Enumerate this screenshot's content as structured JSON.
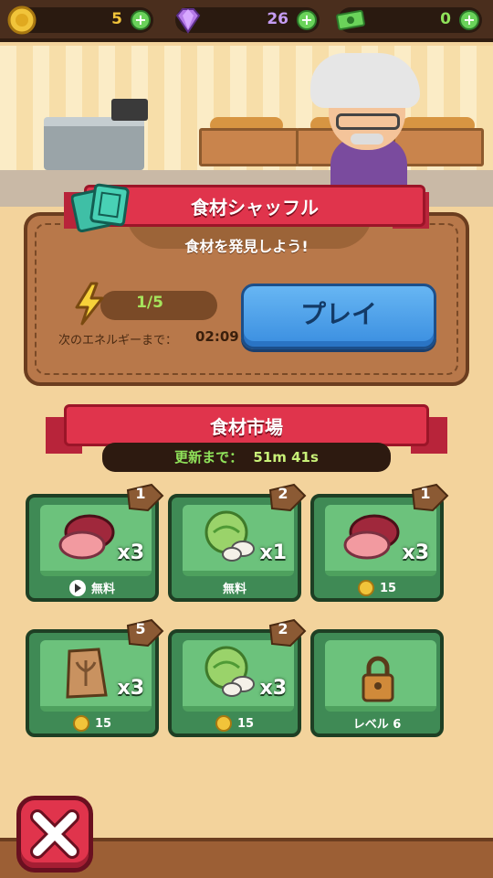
{
  "currency": {
    "coins": "5",
    "gems": "26",
    "cash": "0",
    "plus_symbol": "+"
  },
  "shuffle": {
    "title": "食材シャッフル",
    "subtitle": "食材を発見しよう!",
    "energy": "1/5",
    "energy_fill_fraction": 0.2,
    "next_energy_label": "次のエネルギーまで：",
    "next_energy_time": "02:09",
    "play_label": "プレイ"
  },
  "market": {
    "title": "食材市場",
    "refresh_label": "更新まで：",
    "refresh_time": "51m 41s",
    "items": [
      {
        "tag": "1",
        "qty": "x3",
        "price": "無料",
        "price_type": "ad",
        "icon": "meat-icon"
      },
      {
        "tag": "2",
        "qty": "x1",
        "price": "無料",
        "price_type": "free",
        "icon": "cabbage-mushroom-icon"
      },
      {
        "tag": "1",
        "qty": "x3",
        "price": "15",
        "price_type": "coin",
        "icon": "meat-icon"
      },
      {
        "tag": "5",
        "qty": "x3",
        "price": "15",
        "price_type": "coin",
        "icon": "seed-bag-icon"
      },
      {
        "tag": "2",
        "qty": "x3",
        "price": "15",
        "price_type": "coin",
        "icon": "cabbage-mushroom-icon"
      },
      {
        "tag": "",
        "qty": "",
        "price": "レベル 6",
        "price_type": "locked",
        "icon": "lock-icon"
      }
    ]
  },
  "colors": {
    "ribbon": "#e0344c",
    "crate": "#3f8a55",
    "play": "#4ea2ea",
    "energy": "#a6e45c"
  }
}
